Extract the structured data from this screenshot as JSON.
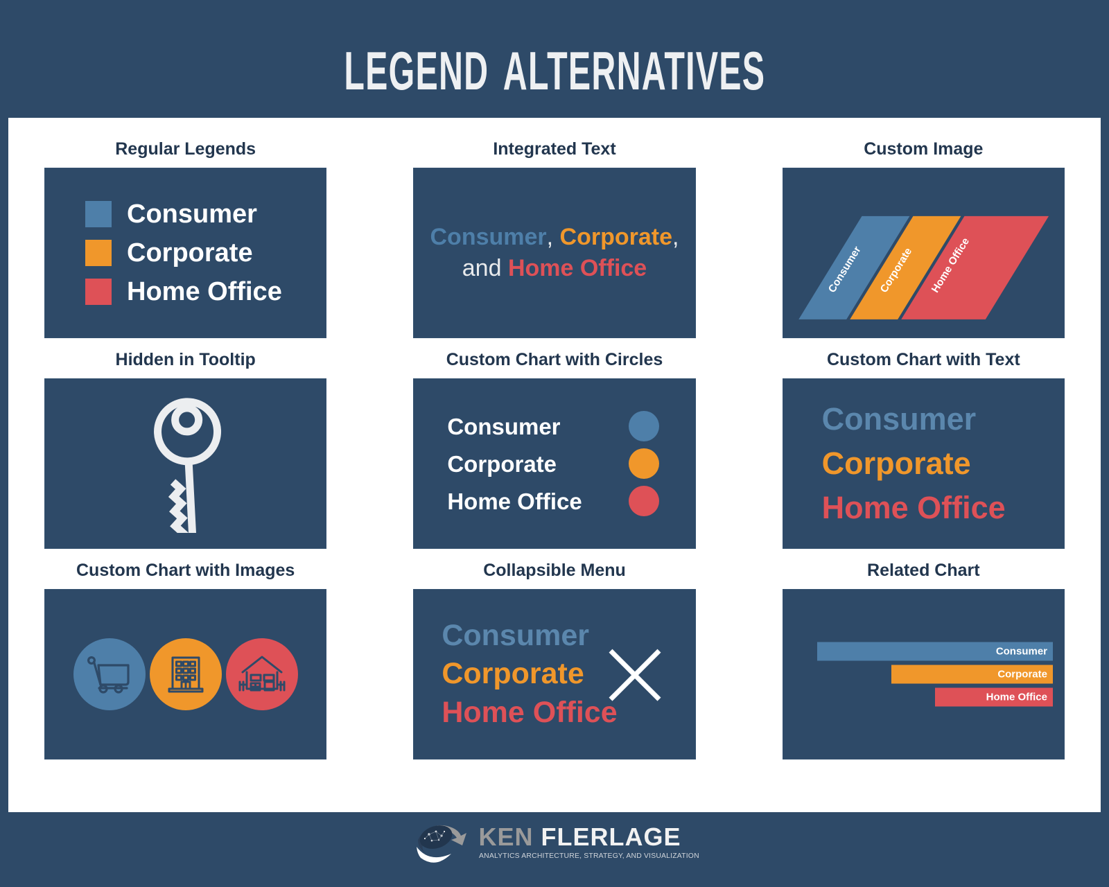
{
  "header": {
    "title": "Legend Alternatives"
  },
  "colors": {
    "background": "#2e4a68",
    "panel": "#2e4a68",
    "board": "#ffffff",
    "consumer": "#4e7fa9",
    "corporate": "#f0972b",
    "home_office": "#de5157",
    "white": "#ffffff",
    "title_text": "#22364e"
  },
  "categories": [
    "Consumer",
    "Corporate",
    "Home Office"
  ],
  "panels": [
    {
      "key": "regular_legends",
      "title": "Regular Legends",
      "items": [
        {
          "label": "Consumer",
          "color": "#4e7fa9"
        },
        {
          "label": "Corporate",
          "color": "#f0972b"
        },
        {
          "label": "Home Office",
          "color": "#de5157"
        }
      ]
    },
    {
      "key": "integrated_text",
      "title": "Integrated Text",
      "segments": [
        {
          "text": "Consumer",
          "color": "#4e7fa9",
          "bold": true
        },
        {
          "text": ", ",
          "color": "#e8eaec",
          "bold": false
        },
        {
          "text": "Corporate",
          "color": "#f0972b",
          "bold": true
        },
        {
          "text": ", ",
          "color": "#e8eaec",
          "bold": false
        },
        {
          "text": "and ",
          "color": "#e8eaec",
          "bold": false
        },
        {
          "text": "Home Office",
          "color": "#de5157",
          "bold": true
        }
      ]
    },
    {
      "key": "custom_image",
      "title": "Custom Image",
      "bands": [
        {
          "label": "Consumer",
          "color": "#4e7fa9"
        },
        {
          "label": "Corporate",
          "color": "#f0972b"
        },
        {
          "label": "Home Office",
          "color": "#de5157"
        }
      ]
    },
    {
      "key": "hidden_in_tooltip",
      "title": "Hidden in Tooltip",
      "icon": "key-icon",
      "icon_color": "#eceef0"
    },
    {
      "key": "custom_chart_circles",
      "title": "Custom Chart with Circles",
      "items": [
        {
          "label": "Consumer",
          "color": "#4e7fa9"
        },
        {
          "label": "Corporate",
          "color": "#f0972b"
        },
        {
          "label": "Home Office",
          "color": "#de5157"
        }
      ]
    },
    {
      "key": "custom_chart_text",
      "title": "Custom Chart with Text",
      "items": [
        {
          "label": "Consumer",
          "color": "#5b87ad"
        },
        {
          "label": "Corporate",
          "color": "#f0972b"
        },
        {
          "label": "Home Office",
          "color": "#de5157"
        }
      ]
    },
    {
      "key": "custom_chart_images",
      "title": "Custom Chart with Images",
      "items": [
        {
          "label": "Consumer",
          "color": "#4e7fa9",
          "icon": "shopping-cart-icon"
        },
        {
          "label": "Corporate",
          "color": "#f0972b",
          "icon": "office-building-icon"
        },
        {
          "label": "Home Office",
          "color": "#de5157",
          "icon": "house-icon"
        }
      ]
    },
    {
      "key": "collapsible_menu",
      "title": "Collapsible Menu",
      "items": [
        {
          "label": "Consumer",
          "color": "#5b87ad"
        },
        {
          "label": "Corporate",
          "color": "#f0972b"
        },
        {
          "label": "Home Office",
          "color": "#de5157"
        }
      ],
      "close_icon": "close-x-icon"
    },
    {
      "key": "related_chart",
      "title": "Related Chart",
      "chart_data": {
        "type": "bar",
        "orientation": "horizontal",
        "categories": [
          "Consumer",
          "Corporate",
          "Home Office"
        ],
        "values": [
          100,
          68,
          50
        ],
        "colors": [
          "#4e7fa9",
          "#f0972b",
          "#de5157"
        ],
        "title": "Related Chart",
        "xlabel": "",
        "ylabel": "",
        "xlim": [
          0,
          100
        ],
        "grid": false,
        "legend": "inside-bar-labels",
        "labels_inside": true
      }
    }
  ],
  "footer": {
    "logo_first": "KEN",
    "logo_second": "FLERLAGE",
    "tagline": "ANALYTICS ARCHITECTURE, STRATEGY, AND VISUALIZATION"
  }
}
